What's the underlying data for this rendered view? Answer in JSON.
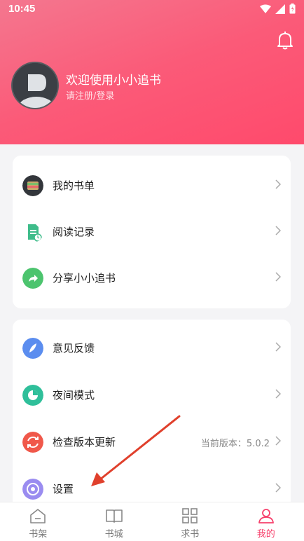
{
  "status": {
    "time": "10:45"
  },
  "profile": {
    "welcome": "欢迎使用小小追书",
    "login": "请注册/登录"
  },
  "menu_group1": [
    {
      "label": "我的书单",
      "icon": "book-list-icon"
    },
    {
      "label": "阅读记录",
      "icon": "reading-history-icon"
    },
    {
      "label": "分享小小追书",
      "icon": "share-icon"
    }
  ],
  "menu_group2": [
    {
      "label": "意见反馈",
      "icon": "feedback-icon"
    },
    {
      "label": "夜间模式",
      "icon": "night-mode-icon"
    },
    {
      "label": "检查版本更新",
      "icon": "update-icon",
      "extra": "当前版本：5.0.2"
    },
    {
      "label": "设置",
      "icon": "settings-icon"
    }
  ],
  "tabs": [
    {
      "label": "书架",
      "icon": "bookshelf-icon"
    },
    {
      "label": "书城",
      "icon": "bookstore-icon"
    },
    {
      "label": "求书",
      "icon": "request-icon"
    },
    {
      "label": "我的",
      "icon": "profile-icon",
      "active": true
    }
  ],
  "colors": {
    "accent": "#f6416c",
    "header_start": "#f4778f",
    "header_end": "#ff4a6c",
    "annotation": "#e0402c"
  }
}
